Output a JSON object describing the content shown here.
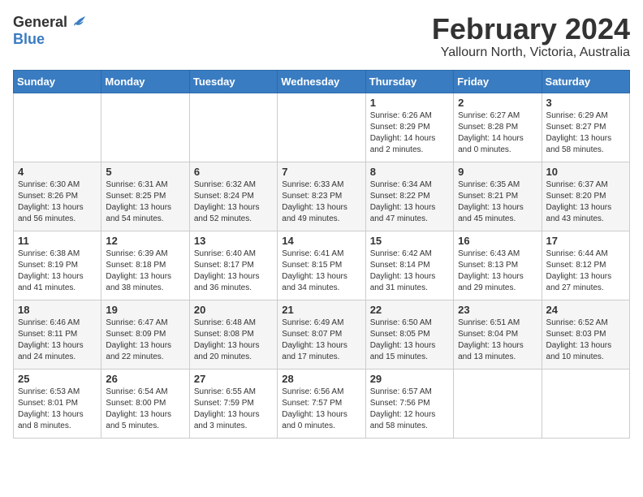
{
  "logo": {
    "general": "General",
    "blue": "Blue"
  },
  "title": {
    "month_year": "February 2024",
    "location": "Yallourn North, Victoria, Australia"
  },
  "days_of_week": [
    "Sunday",
    "Monday",
    "Tuesday",
    "Wednesday",
    "Thursday",
    "Friday",
    "Saturday"
  ],
  "weeks": [
    [
      {
        "day": "",
        "info": ""
      },
      {
        "day": "",
        "info": ""
      },
      {
        "day": "",
        "info": ""
      },
      {
        "day": "",
        "info": ""
      },
      {
        "day": "1",
        "info": "Sunrise: 6:26 AM\nSunset: 8:29 PM\nDaylight: 14 hours\nand 2 minutes."
      },
      {
        "day": "2",
        "info": "Sunrise: 6:27 AM\nSunset: 8:28 PM\nDaylight: 14 hours\nand 0 minutes."
      },
      {
        "day": "3",
        "info": "Sunrise: 6:29 AM\nSunset: 8:27 PM\nDaylight: 13 hours\nand 58 minutes."
      }
    ],
    [
      {
        "day": "4",
        "info": "Sunrise: 6:30 AM\nSunset: 8:26 PM\nDaylight: 13 hours\nand 56 minutes."
      },
      {
        "day": "5",
        "info": "Sunrise: 6:31 AM\nSunset: 8:25 PM\nDaylight: 13 hours\nand 54 minutes."
      },
      {
        "day": "6",
        "info": "Sunrise: 6:32 AM\nSunset: 8:24 PM\nDaylight: 13 hours\nand 52 minutes."
      },
      {
        "day": "7",
        "info": "Sunrise: 6:33 AM\nSunset: 8:23 PM\nDaylight: 13 hours\nand 49 minutes."
      },
      {
        "day": "8",
        "info": "Sunrise: 6:34 AM\nSunset: 8:22 PM\nDaylight: 13 hours\nand 47 minutes."
      },
      {
        "day": "9",
        "info": "Sunrise: 6:35 AM\nSunset: 8:21 PM\nDaylight: 13 hours\nand 45 minutes."
      },
      {
        "day": "10",
        "info": "Sunrise: 6:37 AM\nSunset: 8:20 PM\nDaylight: 13 hours\nand 43 minutes."
      }
    ],
    [
      {
        "day": "11",
        "info": "Sunrise: 6:38 AM\nSunset: 8:19 PM\nDaylight: 13 hours\nand 41 minutes."
      },
      {
        "day": "12",
        "info": "Sunrise: 6:39 AM\nSunset: 8:18 PM\nDaylight: 13 hours\nand 38 minutes."
      },
      {
        "day": "13",
        "info": "Sunrise: 6:40 AM\nSunset: 8:17 PM\nDaylight: 13 hours\nand 36 minutes."
      },
      {
        "day": "14",
        "info": "Sunrise: 6:41 AM\nSunset: 8:15 PM\nDaylight: 13 hours\nand 34 minutes."
      },
      {
        "day": "15",
        "info": "Sunrise: 6:42 AM\nSunset: 8:14 PM\nDaylight: 13 hours\nand 31 minutes."
      },
      {
        "day": "16",
        "info": "Sunrise: 6:43 AM\nSunset: 8:13 PM\nDaylight: 13 hours\nand 29 minutes."
      },
      {
        "day": "17",
        "info": "Sunrise: 6:44 AM\nSunset: 8:12 PM\nDaylight: 13 hours\nand 27 minutes."
      }
    ],
    [
      {
        "day": "18",
        "info": "Sunrise: 6:46 AM\nSunset: 8:11 PM\nDaylight: 13 hours\nand 24 minutes."
      },
      {
        "day": "19",
        "info": "Sunrise: 6:47 AM\nSunset: 8:09 PM\nDaylight: 13 hours\nand 22 minutes."
      },
      {
        "day": "20",
        "info": "Sunrise: 6:48 AM\nSunset: 8:08 PM\nDaylight: 13 hours\nand 20 minutes."
      },
      {
        "day": "21",
        "info": "Sunrise: 6:49 AM\nSunset: 8:07 PM\nDaylight: 13 hours\nand 17 minutes."
      },
      {
        "day": "22",
        "info": "Sunrise: 6:50 AM\nSunset: 8:05 PM\nDaylight: 13 hours\nand 15 minutes."
      },
      {
        "day": "23",
        "info": "Sunrise: 6:51 AM\nSunset: 8:04 PM\nDaylight: 13 hours\nand 13 minutes."
      },
      {
        "day": "24",
        "info": "Sunrise: 6:52 AM\nSunset: 8:03 PM\nDaylight: 13 hours\nand 10 minutes."
      }
    ],
    [
      {
        "day": "25",
        "info": "Sunrise: 6:53 AM\nSunset: 8:01 PM\nDaylight: 13 hours\nand 8 minutes."
      },
      {
        "day": "26",
        "info": "Sunrise: 6:54 AM\nSunset: 8:00 PM\nDaylight: 13 hours\nand 5 minutes."
      },
      {
        "day": "27",
        "info": "Sunrise: 6:55 AM\nSunset: 7:59 PM\nDaylight: 13 hours\nand 3 minutes."
      },
      {
        "day": "28",
        "info": "Sunrise: 6:56 AM\nSunset: 7:57 PM\nDaylight: 13 hours\nand 0 minutes."
      },
      {
        "day": "29",
        "info": "Sunrise: 6:57 AM\nSunset: 7:56 PM\nDaylight: 12 hours\nand 58 minutes."
      },
      {
        "day": "",
        "info": ""
      },
      {
        "day": "",
        "info": ""
      }
    ]
  ]
}
